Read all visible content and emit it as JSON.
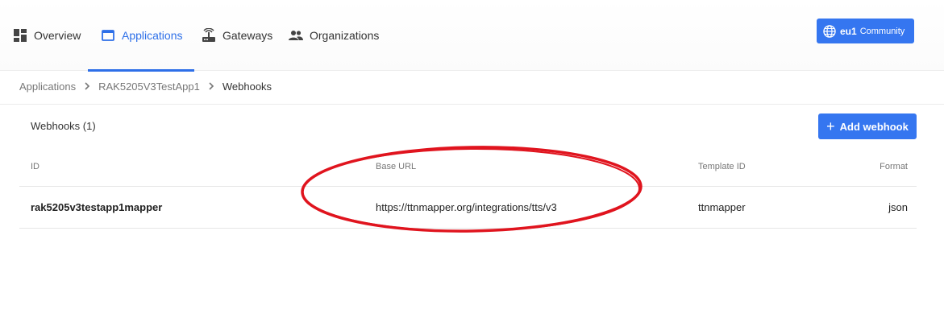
{
  "nav": {
    "items": [
      {
        "label": "Overview",
        "icon": "dashboard-icon"
      },
      {
        "label": "Applications",
        "icon": "window-icon",
        "active": true
      },
      {
        "label": "Gateways",
        "icon": "gateway-router-icon"
      },
      {
        "label": "Organizations",
        "icon": "people-icon"
      }
    ],
    "cluster": {
      "name": "eu1",
      "label": "Community",
      "icon": "globe-icon"
    }
  },
  "breadcrumb": {
    "items": [
      "Applications",
      "RAK5205V3TestApp1"
    ],
    "current": "Webhooks"
  },
  "webhooks": {
    "title": "Webhooks (1)",
    "add_label": "Add webhook",
    "columns": {
      "id": "ID",
      "base_url": "Base URL",
      "template_id": "Template ID",
      "format": "Format"
    },
    "rows": [
      {
        "id": "rak5205v3testapp1mapper",
        "base_url": "https://ttnmapper.org/integrations/tts/v3",
        "template_id": "ttnmapper",
        "format": "json"
      }
    ]
  },
  "colors": {
    "accent": "#3576f0",
    "annotation": "#e0141e"
  }
}
